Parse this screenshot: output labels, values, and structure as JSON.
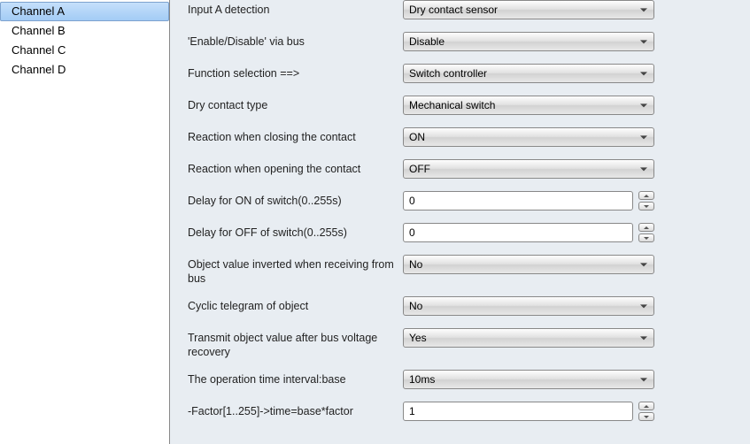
{
  "sidebar": {
    "items": [
      {
        "label": "Channel A",
        "active": true
      },
      {
        "label": "Channel B",
        "active": false
      },
      {
        "label": "Channel C",
        "active": false
      },
      {
        "label": "Channel D",
        "active": false
      }
    ]
  },
  "fields": {
    "input_detection": {
      "label": "Input A detection",
      "value": "Dry contact sensor",
      "type": "dropdown"
    },
    "enable_disable": {
      "label": "'Enable/Disable' via bus",
      "value": "Disable",
      "type": "dropdown"
    },
    "function_selection": {
      "label": "Function selection ==>",
      "value": "Switch controller",
      "type": "dropdown"
    },
    "dry_contact_type": {
      "label": "Dry contact type",
      "value": "Mechanical switch",
      "type": "dropdown"
    },
    "reaction_close": {
      "label": "Reaction when closing the contact",
      "value": "ON",
      "type": "dropdown"
    },
    "reaction_open": {
      "label": "Reaction when opening the contact",
      "value": "OFF",
      "type": "dropdown"
    },
    "delay_on": {
      "label": "Delay for ON of switch(0..255s)",
      "value": "0",
      "type": "numeric"
    },
    "delay_off": {
      "label": "Delay for OFF of switch(0..255s)",
      "value": "0",
      "type": "numeric"
    },
    "object_inverted": {
      "label": "Object value inverted when receiving from bus",
      "value": "No",
      "type": "dropdown"
    },
    "cyclic_telegram": {
      "label": "Cyclic telegram of object",
      "value": "No",
      "type": "dropdown"
    },
    "transmit_recovery": {
      "label": "Transmit object value after bus voltage recovery",
      "value": "Yes",
      "type": "dropdown"
    },
    "operation_interval": {
      "label": "The operation time interval:base",
      "value": "10ms",
      "type": "dropdown"
    },
    "factor": {
      "label": "-Factor[1..255]->time=base*factor",
      "value": "1",
      "type": "numeric"
    }
  }
}
